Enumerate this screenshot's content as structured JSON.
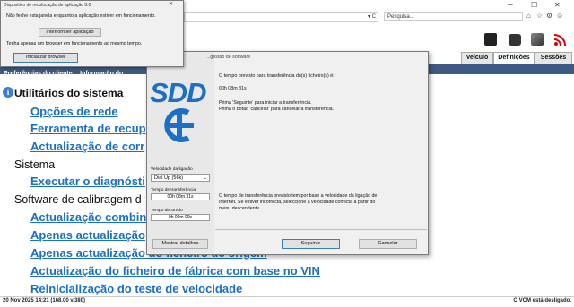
{
  "browser": {
    "search_placeholder": "Pesquisa...",
    "address_fragment": "▾ C"
  },
  "tabs": [
    "Veículo",
    "Definições",
    "Sessões"
  ],
  "breadcrumb": {
    "left": "Preferências do cliente",
    "middle": "Informação do"
  },
  "content": {
    "section_title": "Utilitários do sistema",
    "links_utils": [
      "Opções de rede",
      "Ferramenta de recup",
      "Actualização de corr"
    ],
    "section_sistema": "Sistema",
    "links_sistema": [
      "Executar o diagnósti"
    ],
    "section_software": "Software de calibragem d",
    "links_software": [
      "Actualização combin",
      "Apenas actualização",
      "Apenas actualização do ficheiro de origem",
      "Actualização do ficheiro de fábrica com base no VIN",
      "Reinicialização do teste de velocidade"
    ]
  },
  "status_bar": {
    "left": "20 Nov 2025 14:21 (168.00 v.380)",
    "right": "O VCM está desligado."
  },
  "small_dialog": {
    "title": "Dispositivo de recolocação de aplicação 8.0",
    "message1": "Não feche esta janela enquanto a aplicação estiver em funcionamento.",
    "button1": "Interromper aplicação",
    "message2": "Tenha apenas um browser em funcionamento ao mesmo tempo.",
    "button2": "Inicializar browser"
  },
  "big_dialog": {
    "title": "...gestão de software",
    "logo": "SDD",
    "line1": "O tempo previsto para transferência do(s) ficheiro(s) é:",
    "line2": "00h 08m 31s",
    "line3": "Prima 'Seguinte' para iniciar a transferência.",
    "line4": "Prima o botão 'cancelar' para cancelar a transferência.",
    "note1": "O tempo de transferência previsto tem por base a velocidade da ligação de",
    "note2": "Internet. Se estiver incorrecta, seleccione a velocidade correcta a partir do",
    "note3": "menu descendente.",
    "speed_label": "Velocidade da ligação",
    "speed_value": "Dial Up (56k)",
    "transfer_label": "Tempo de transferência",
    "transfer_value": "00h 08m 31s",
    "elapsed_label": "Tempo decorrido",
    "elapsed_value": "0h 00m 00s",
    "details_button": "Mostrar detalhes",
    "next_button": "Seguinte",
    "cancel_button": "Cancelar"
  },
  "colors": {
    "link": "#1a6fc9",
    "breadcrumb_bg": "#3e5a83",
    "logo_blue": "#1c6fc4"
  }
}
